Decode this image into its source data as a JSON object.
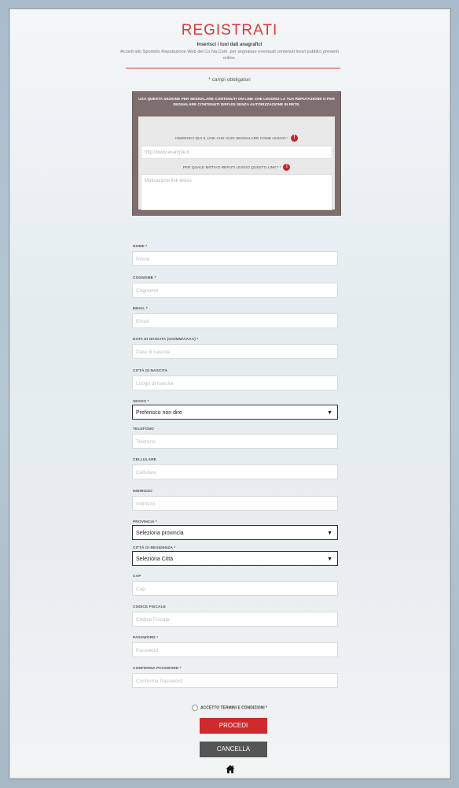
{
  "header": {
    "title": "REGISTRATI",
    "subtitle": "Inserisci i tuoi dati anagrafici",
    "intro": "Accedi allo Sportello Reputazione Web del Co.Na.Com. per segnalare eventuali contenuti lesivi pubblici presenti online.",
    "required_note": "* campi obbligatori"
  },
  "report": {
    "heading": "USA QUESTA SEZIONE PER SEGNALARE CONTENUTI ON-LINE CHE LEDONO LA TUA REPUTAZIONE O PER SEGNALARE CONTENUTI DIFFUSI SENZA AUTORIZZAZIONE IN RETE.",
    "link_label": "INSERISCI QUI IL LINK CHE VUOI SEGNALARE COME LESIVO *",
    "link_placeholder": "http://www.example.it",
    "reason_label": "PER QUALE MOTIVO REPUTI LESIVO QUESTO LINK? *",
    "reason_placeholder": "Motivazione link lesivo"
  },
  "fields": {
    "nome": {
      "label": "NOME *",
      "placeholder": "Nome"
    },
    "cognome": {
      "label": "COGNOME *",
      "placeholder": "Cognome"
    },
    "email": {
      "label": "EMAIL *",
      "placeholder": "Email"
    },
    "nascita": {
      "label": "DATA DI NASCITA (GG/MM/AAAA) *",
      "placeholder": "Data di nascita"
    },
    "citta_nascita": {
      "label": "CITTÀ DI NASCITA",
      "placeholder": "Luogo di nascita"
    },
    "sesso": {
      "label": "SESSO *",
      "value": "Preferisco non dire"
    },
    "telefono": {
      "label": "TELEFONO",
      "placeholder": "Telefono"
    },
    "cellulare": {
      "label": "CELLULARE",
      "placeholder": "Cellulare"
    },
    "indirizzo": {
      "label": "INDIRIZZO",
      "placeholder": "Indirizzo"
    },
    "provincia": {
      "label": "PROVINCIA *",
      "value": "Seleziona provincia"
    },
    "citta_residenza": {
      "label": "CITTÀ DI RESIDENZA *",
      "value": "Seleziona Città"
    },
    "cap": {
      "label": "CAP",
      "placeholder": "Cap"
    },
    "codice_fiscale": {
      "label": "CODICE FISCALE",
      "placeholder": "Codice Fiscale"
    },
    "password": {
      "label": "PASSWORD *",
      "placeholder": "Password"
    },
    "conferma": {
      "label": "CONFERMA PASSWORD *",
      "placeholder": "Conferma Password"
    }
  },
  "terms": "ACCETTO TERMINI E CONDIZIONI *",
  "buttons": {
    "submit": "PROCEDI",
    "cancel": "CANCELLA"
  },
  "colors": {
    "accent": "#d02a2f",
    "dark_button": "#555555"
  },
  "icons": {
    "info": "info-icon",
    "home": "home-icon",
    "caret": "chevron-down-icon"
  }
}
